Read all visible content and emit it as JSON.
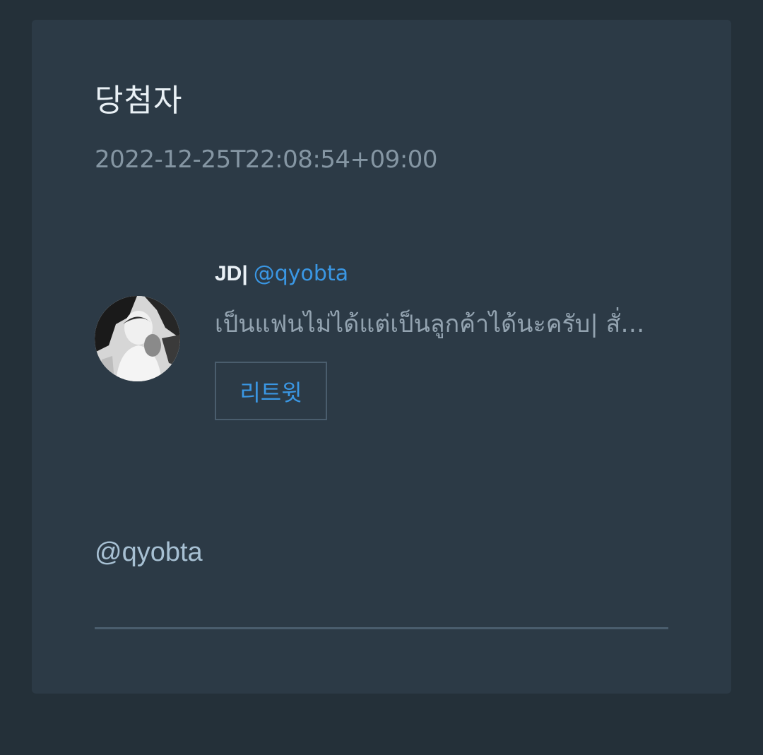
{
  "card": {
    "title": "당첨자",
    "timestamp": "2022-12-25T22:08:54+09:00"
  },
  "tweet": {
    "user_name": "JD|",
    "user_handle": "@qyobta",
    "text": "เป็นแฟนไม่ได้แต่เป็นลูกค้าได้นะครับ| สั่…",
    "avatar_icon": "user-avatar-photo",
    "retweet_label": "리트윗"
  },
  "mention": "@qyobta",
  "colors": {
    "page_bg": "#243039",
    "card_bg": "#2c3a46",
    "accent": "#3a97e4",
    "divider": "#4a5d6d"
  }
}
